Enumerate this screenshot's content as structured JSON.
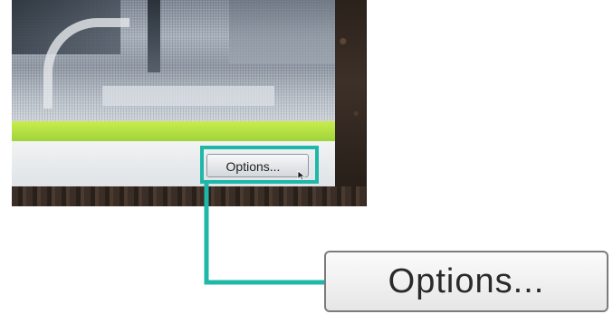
{
  "screenshot": {
    "small_button_label": "Options...",
    "zoom_button_label": "Options...",
    "green_bar_color": "#a6d83b",
    "highlight_color": "#1fb8a8"
  },
  "icons": {
    "cursor": "cursor-arrow-icon"
  }
}
